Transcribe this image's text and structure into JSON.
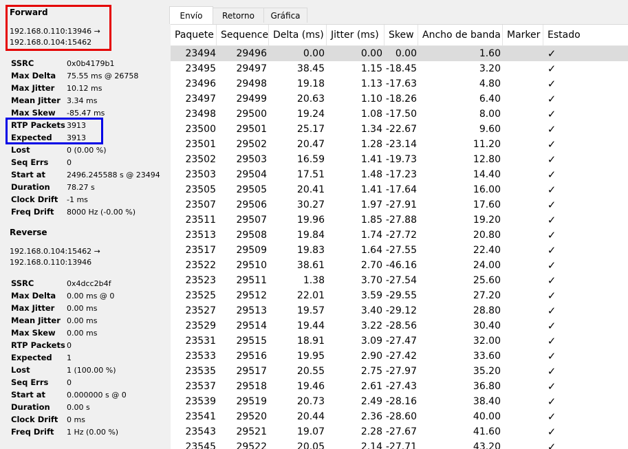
{
  "forward": {
    "title": "Forward",
    "address": "192.168.0.110:13946 →\n192.168.0.104:15462",
    "stats": [
      {
        "key": "SSRC",
        "value": "0x0b4179b1"
      },
      {
        "key": "Max Delta",
        "value": "75.55 ms @ 26758"
      },
      {
        "key": "Max Jitter",
        "value": "10.12 ms"
      },
      {
        "key": "Mean Jitter",
        "value": "3.34 ms"
      },
      {
        "key": "Max Skew",
        "value": "-85.47 ms"
      },
      {
        "key": "RTP Packets",
        "value": "3913"
      },
      {
        "key": "Expected",
        "value": "3913"
      },
      {
        "key": "Lost",
        "value": "0 (0.00 %)"
      },
      {
        "key": "Seq Errs",
        "value": "0"
      },
      {
        "key": "Start at",
        "value": "2496.245588 s @ 23494"
      },
      {
        "key": "Duration",
        "value": "78.27 s"
      },
      {
        "key": "Clock Drift",
        "value": "-1 ms"
      },
      {
        "key": "Freq Drift",
        "value": "8000 Hz (-0.00 %)"
      }
    ]
  },
  "reverse": {
    "title": "Reverse",
    "address": "192.168.0.104:15462 →\n192.168.0.110:13946",
    "stats": [
      {
        "key": "SSRC",
        "value": "0x4dcc2b4f"
      },
      {
        "key": "Max Delta",
        "value": "0.00 ms @ 0"
      },
      {
        "key": "Max Jitter",
        "value": "0.00 ms"
      },
      {
        "key": "Mean Jitter",
        "value": "0.00 ms"
      },
      {
        "key": "Max Skew",
        "value": "0.00 ms"
      },
      {
        "key": "RTP Packets",
        "value": "0"
      },
      {
        "key": "Expected",
        "value": "1"
      },
      {
        "key": "Lost",
        "value": "1 (100.00 %)"
      },
      {
        "key": "Seq Errs",
        "value": "0"
      },
      {
        "key": "Start at",
        "value": "0.000000 s @ 0"
      },
      {
        "key": "Duration",
        "value": "0.00 s"
      },
      {
        "key": "Clock Drift",
        "value": "0 ms"
      },
      {
        "key": "Freq Drift",
        "value": "1 Hz (0.00 %)"
      }
    ]
  },
  "tabs": [
    {
      "label": "Envío",
      "active": true
    },
    {
      "label": "Retorno",
      "active": false
    },
    {
      "label": "Gráfica",
      "active": false
    }
  ],
  "columns": [
    "Paquete",
    "Sequence",
    "Delta (ms)",
    "Jitter (ms)",
    "Skew",
    "Ancho de banda",
    "Marker",
    "Estado"
  ],
  "status_glyph": "✓",
  "rows": [
    [
      "23494",
      "29496",
      "0.00",
      "0.00",
      "0.00",
      "1.60",
      "",
      ""
    ],
    [
      "23495",
      "29497",
      "38.45",
      "1.15",
      "-18.45",
      "3.20",
      "",
      ""
    ],
    [
      "23496",
      "29498",
      "19.18",
      "1.13",
      "-17.63",
      "4.80",
      "",
      ""
    ],
    [
      "23497",
      "29499",
      "20.63",
      "1.10",
      "-18.26",
      "6.40",
      "",
      ""
    ],
    [
      "23498",
      "29500",
      "19.24",
      "1.08",
      "-17.50",
      "8.00",
      "",
      ""
    ],
    [
      "23500",
      "29501",
      "25.17",
      "1.34",
      "-22.67",
      "9.60",
      "",
      ""
    ],
    [
      "23501",
      "29502",
      "20.47",
      "1.28",
      "-23.14",
      "11.20",
      "",
      ""
    ],
    [
      "23502",
      "29503",
      "16.59",
      "1.41",
      "-19.73",
      "12.80",
      "",
      ""
    ],
    [
      "23503",
      "29504",
      "17.51",
      "1.48",
      "-17.23",
      "14.40",
      "",
      ""
    ],
    [
      "23505",
      "29505",
      "20.41",
      "1.41",
      "-17.64",
      "16.00",
      "",
      ""
    ],
    [
      "23507",
      "29506",
      "30.27",
      "1.97",
      "-27.91",
      "17.60",
      "",
      ""
    ],
    [
      "23511",
      "29507",
      "19.96",
      "1.85",
      "-27.88",
      "19.20",
      "",
      ""
    ],
    [
      "23513",
      "29508",
      "19.84",
      "1.74",
      "-27.72",
      "20.80",
      "",
      ""
    ],
    [
      "23517",
      "29509",
      "19.83",
      "1.64",
      "-27.55",
      "22.40",
      "",
      ""
    ],
    [
      "23522",
      "29510",
      "38.61",
      "2.70",
      "-46.16",
      "24.00",
      "",
      ""
    ],
    [
      "23523",
      "29511",
      "1.38",
      "3.70",
      "-27.54",
      "25.60",
      "",
      ""
    ],
    [
      "23525",
      "29512",
      "22.01",
      "3.59",
      "-29.55",
      "27.20",
      "",
      ""
    ],
    [
      "23527",
      "29513",
      "19.57",
      "3.40",
      "-29.12",
      "28.80",
      "",
      ""
    ],
    [
      "23529",
      "29514",
      "19.44",
      "3.22",
      "-28.56",
      "30.40",
      "",
      ""
    ],
    [
      "23531",
      "29515",
      "18.91",
      "3.09",
      "-27.47",
      "32.00",
      "",
      ""
    ],
    [
      "23533",
      "29516",
      "19.95",
      "2.90",
      "-27.42",
      "33.60",
      "",
      ""
    ],
    [
      "23535",
      "29517",
      "20.55",
      "2.75",
      "-27.97",
      "35.20",
      "",
      ""
    ],
    [
      "23537",
      "29518",
      "19.46",
      "2.61",
      "-27.43",
      "36.80",
      "",
      ""
    ],
    [
      "23539",
      "29519",
      "20.73",
      "2.49",
      "-28.16",
      "38.40",
      "",
      ""
    ],
    [
      "23541",
      "29520",
      "20.44",
      "2.36",
      "-28.60",
      "40.00",
      "",
      ""
    ],
    [
      "23543",
      "29521",
      "19.07",
      "2.28",
      "-27.67",
      "41.60",
      "",
      ""
    ],
    [
      "23545",
      "29522",
      "20.05",
      "2.14",
      "-27.71",
      "43.20",
      "",
      ""
    ]
  ]
}
